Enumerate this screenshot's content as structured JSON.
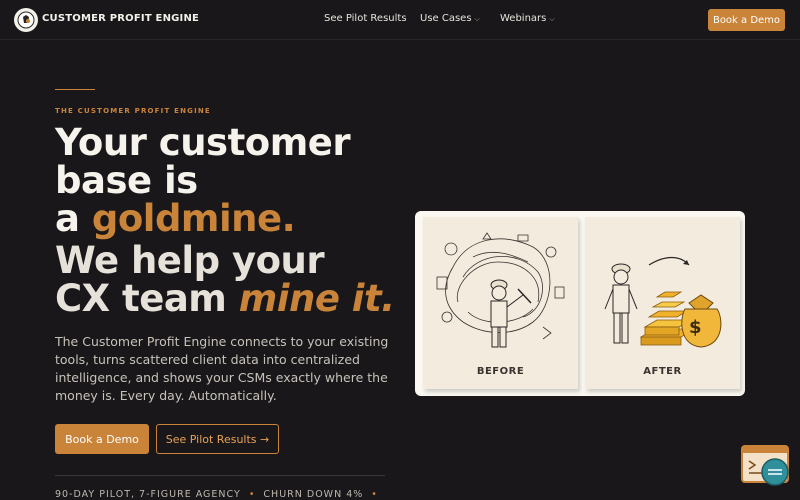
{
  "nav": {
    "brand": "CUSTOMER PROFIT ENGINE",
    "links": [
      {
        "label": "See Pilot Results",
        "dropdown": false
      },
      {
        "label": "Use Cases",
        "dropdown": true
      },
      {
        "label": "Webinars",
        "dropdown": true
      }
    ],
    "cta": "Book a Demo"
  },
  "hero": {
    "eyebrow": "THE CUSTOMER PROFIT ENGINE",
    "headline_line1": "Your customer",
    "headline_line2": "base is",
    "headline_line3_prefix": "a ",
    "headline_line3_accent": "goldmine.",
    "subhead_line1": "We help your",
    "subhead_line2_prefix": "CX team ",
    "subhead_line2_accent": "mine it.",
    "description": "The Customer Profit Engine connects to your existing tools, turns scattered client data into centralized intelligence, and shows your CSMs exactly where the money is. Every day. Automatically.",
    "primary_cta": "Book a Demo",
    "secondary_cta": "See Pilot Results →",
    "stats": [
      "90-DAY PILOT, 7-FIGURE AGENCY",
      "CHURN DOWN 4%"
    ]
  },
  "illustration": {
    "before_label": "BEFORE",
    "after_label": "AFTER",
    "dollar_sign": "$"
  },
  "colors": {
    "background": "#19171a",
    "accent": "#c9843a",
    "text": "#f6f3ec"
  },
  "icons": [
    "brand-logo-icon",
    "chevron-down-icon",
    "arrow-right-icon",
    "chat-widget-icon"
  ]
}
